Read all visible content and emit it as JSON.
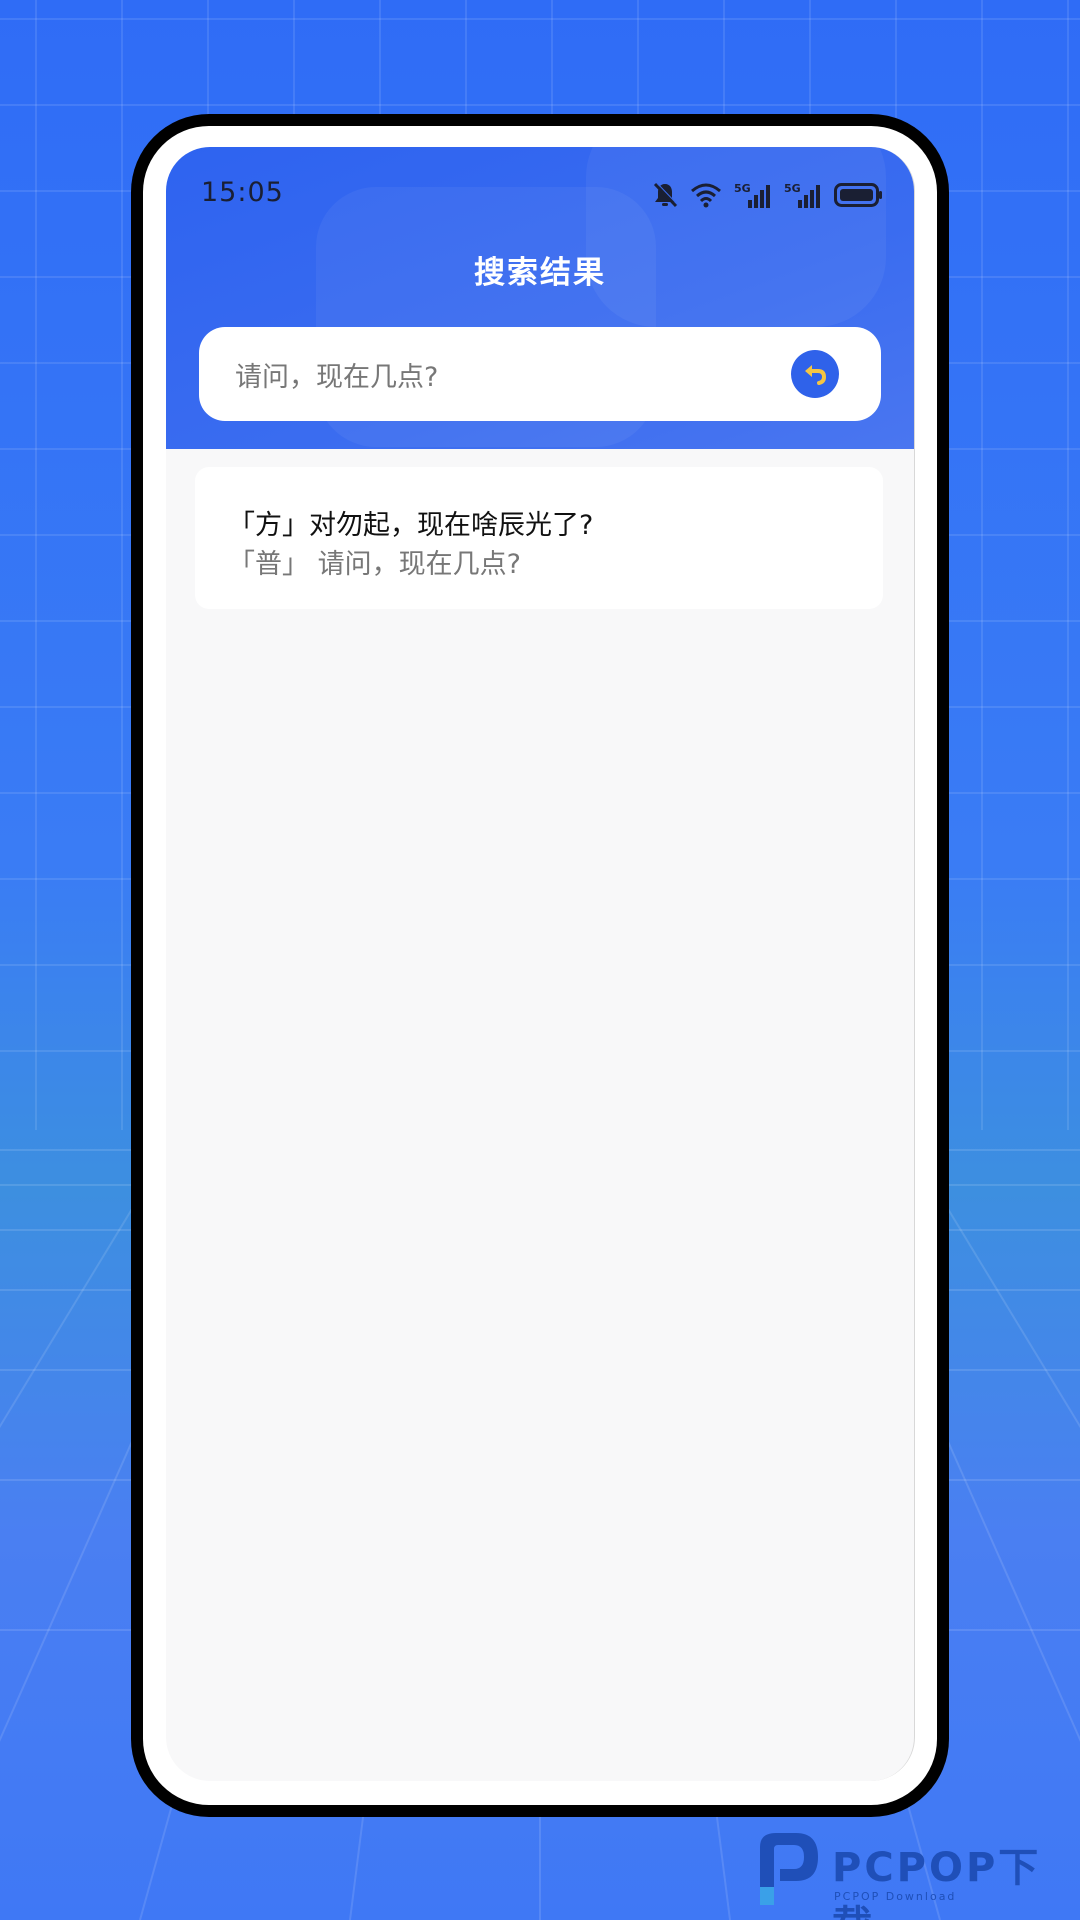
{
  "status_bar": {
    "time": "15:05"
  },
  "header": {
    "title": "搜索结果"
  },
  "search": {
    "query": "请问，现在几点?"
  },
  "results": [
    {
      "dialect_line": "「方」对勿起，现在啥辰光了?",
      "mandarin_line": "「普」 请问，现在几点?"
    }
  ],
  "watermark": {
    "brand": "PCPOP下载",
    "sub": "PCPOP Download"
  },
  "icons": {
    "mute": "bell-off-icon",
    "wifi": "wifi-icon",
    "signal1": "signal-5g-icon",
    "signal2": "signal-5g-icon",
    "battery": "battery-icon",
    "back": "back-arrow-icon"
  },
  "colors": {
    "background": "#3a7cf5",
    "header": "#3468f0",
    "back_button": "#2f62ea",
    "back_arrow": "#f5c542"
  }
}
